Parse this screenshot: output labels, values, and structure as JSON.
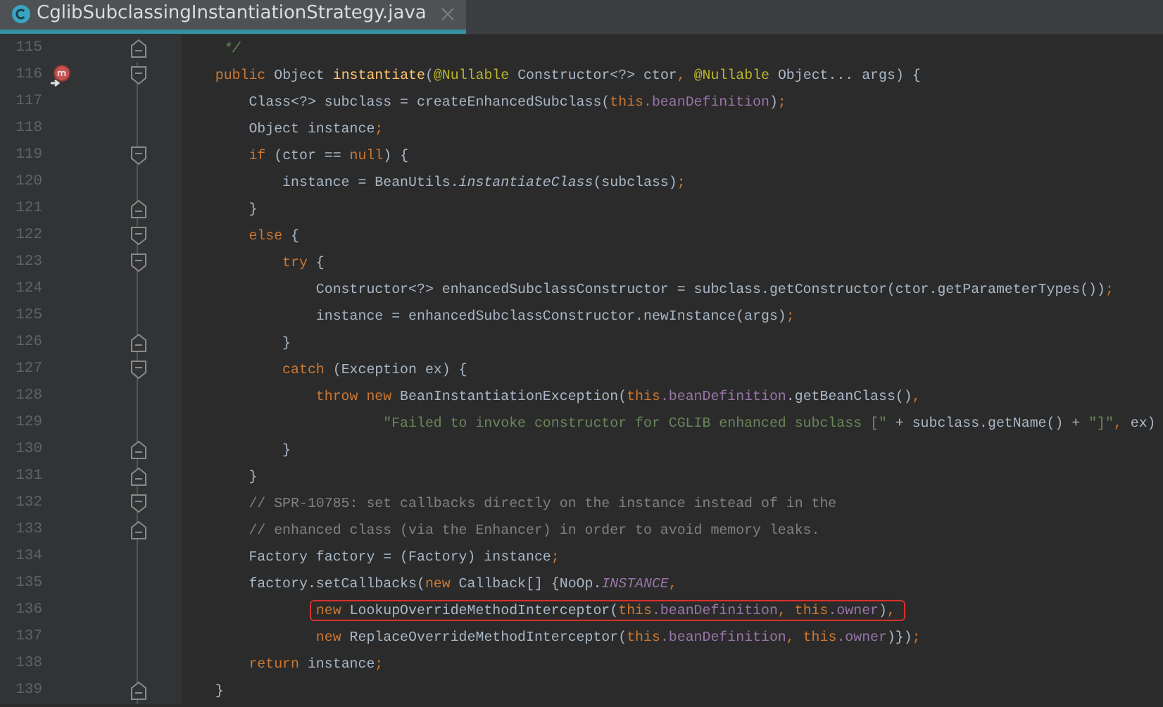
{
  "tab": {
    "title": "CglibSubclassingInstantiationStrategy.java",
    "selected": true
  },
  "lines": [
    {
      "number": "115",
      "fold_end": true,
      "tokens": [
        {
          "kind": "doc",
          "text": "     */"
        }
      ]
    },
    {
      "number": "116",
      "fold_start": true,
      "override_marker": true,
      "tokens": [
        {
          "kind": "keyword",
          "text": "    public"
        },
        {
          "kind": "plain",
          "text": " Object "
        },
        {
          "kind": "method",
          "text": "instantiate"
        },
        {
          "kind": "plain",
          "text": "("
        },
        {
          "kind": "annotation",
          "text": "@Nullable"
        },
        {
          "kind": "plain",
          "text": " Constructor<?> ctor"
        },
        {
          "kind": "punct",
          "text": ","
        },
        {
          "kind": "annotation",
          "text": " @Nullable"
        },
        {
          "kind": "plain",
          "text": " Object... args) {"
        }
      ]
    },
    {
      "number": "117",
      "tokens": [
        {
          "kind": "plain",
          "text": "        Class<?> subclass = createEnhancedSubclass("
        },
        {
          "kind": "keyword",
          "text": "this"
        },
        {
          "kind": "field",
          "text": ".beanDefinition"
        },
        {
          "kind": "plain",
          "text": ")"
        },
        {
          "kind": "punct",
          "text": ";"
        }
      ]
    },
    {
      "number": "118",
      "tokens": [
        {
          "kind": "plain",
          "text": "        Object instance"
        },
        {
          "kind": "punct",
          "text": ";"
        }
      ]
    },
    {
      "number": "119",
      "fold_start": true,
      "tokens": [
        {
          "kind": "keyword",
          "text": "        if"
        },
        {
          "kind": "plain",
          "text": " (ctor == "
        },
        {
          "kind": "keyword",
          "text": "null"
        },
        {
          "kind": "plain",
          "text": ") {"
        }
      ]
    },
    {
      "number": "120",
      "tokens": [
        {
          "kind": "plain",
          "text": "            instance = BeanUtils."
        },
        {
          "kind": "static_method",
          "text": "instantiateClass"
        },
        {
          "kind": "plain",
          "text": "(subclass)"
        },
        {
          "kind": "punct",
          "text": ";"
        }
      ]
    },
    {
      "number": "121",
      "fold_end": true,
      "tokens": [
        {
          "kind": "plain",
          "text": "        }"
        }
      ]
    },
    {
      "number": "122",
      "fold_start": true,
      "tokens": [
        {
          "kind": "keyword",
          "text": "        else"
        },
        {
          "kind": "plain",
          "text": " {"
        }
      ]
    },
    {
      "number": "123",
      "fold_start": true,
      "tokens": [
        {
          "kind": "keyword",
          "text": "            try"
        },
        {
          "kind": "plain",
          "text": " {"
        }
      ]
    },
    {
      "number": "124",
      "tokens": [
        {
          "kind": "plain",
          "text": "                Constructor<?> enhancedSubclassConstructor = subclass.getConstructor(ctor.getParameterTypes())"
        },
        {
          "kind": "punct",
          "text": ";"
        }
      ]
    },
    {
      "number": "125",
      "tokens": [
        {
          "kind": "plain",
          "text": "                instance = enhancedSubclassConstructor.newInstance(args)"
        },
        {
          "kind": "punct",
          "text": ";"
        }
      ]
    },
    {
      "number": "126",
      "fold_end": true,
      "tokens": [
        {
          "kind": "plain",
          "text": "            }"
        }
      ]
    },
    {
      "number": "127",
      "fold_start": true,
      "tokens": [
        {
          "kind": "keyword",
          "text": "            catch"
        },
        {
          "kind": "plain",
          "text": " (Exception ex) {"
        }
      ]
    },
    {
      "number": "128",
      "tokens": [
        {
          "kind": "keyword",
          "text": "                throw new"
        },
        {
          "kind": "plain",
          "text": " BeanInstantiationException("
        },
        {
          "kind": "keyword",
          "text": "this"
        },
        {
          "kind": "field",
          "text": ".beanDefinition"
        },
        {
          "kind": "plain",
          "text": ".getBeanClass()"
        },
        {
          "kind": "punct",
          "text": ","
        }
      ]
    },
    {
      "number": "129",
      "tokens": [
        {
          "kind": "string",
          "text": "                        \"Failed to invoke constructor for CGLIB enhanced subclass [\""
        },
        {
          "kind": "plain",
          "text": " + subclass.getName() + "
        },
        {
          "kind": "string",
          "text": "\"]\""
        },
        {
          "kind": "punct",
          "text": ","
        },
        {
          "kind": "plain",
          "text": " ex)"
        }
      ]
    },
    {
      "number": "130",
      "fold_end": true,
      "tokens": [
        {
          "kind": "plain",
          "text": "            }"
        }
      ]
    },
    {
      "number": "131",
      "fold_end": true,
      "tokens": [
        {
          "kind": "plain",
          "text": "        }"
        }
      ]
    },
    {
      "number": "132",
      "fold_start": true,
      "tokens": [
        {
          "kind": "comment",
          "text": "        // SPR-10785: set callbacks directly on the instance instead of in the"
        }
      ]
    },
    {
      "number": "133",
      "fold_end": true,
      "tokens": [
        {
          "kind": "comment",
          "text": "        // enhanced class (via the Enhancer) in order to avoid memory leaks."
        }
      ]
    },
    {
      "number": "134",
      "tokens": [
        {
          "kind": "plain",
          "text": "        Factory factory = (Factory) instance"
        },
        {
          "kind": "punct",
          "text": ";"
        }
      ]
    },
    {
      "number": "135",
      "tokens": [
        {
          "kind": "plain",
          "text": "        factory.setCallbacks("
        },
        {
          "kind": "keyword",
          "text": "new"
        },
        {
          "kind": "plain",
          "text": " Callback[] {NoOp."
        },
        {
          "kind": "static_field",
          "text": "INSTANCE"
        },
        {
          "kind": "punct",
          "text": ","
        }
      ]
    },
    {
      "number": "136",
      "boxed": true,
      "tokens": [
        {
          "kind": "keyword",
          "text": "                new"
        },
        {
          "kind": "plain",
          "text": " LookupOverrideMethodInterceptor("
        },
        {
          "kind": "keyword",
          "text": "this"
        },
        {
          "kind": "field",
          "text": ".beanDefinition"
        },
        {
          "kind": "punct",
          "text": ","
        },
        {
          "kind": "keyword",
          "text": " this"
        },
        {
          "kind": "field",
          "text": ".owner"
        },
        {
          "kind": "plain",
          "text": ")"
        },
        {
          "kind": "punct",
          "text": ","
        }
      ]
    },
    {
      "number": "137",
      "tokens": [
        {
          "kind": "keyword",
          "text": "                new"
        },
        {
          "kind": "plain",
          "text": " ReplaceOverrideMethodInterceptor("
        },
        {
          "kind": "keyword",
          "text": "this"
        },
        {
          "kind": "field",
          "text": ".beanDefinition"
        },
        {
          "kind": "punct",
          "text": ","
        },
        {
          "kind": "keyword",
          "text": " this"
        },
        {
          "kind": "field",
          "text": ".owner"
        },
        {
          "kind": "plain",
          "text": ")})"
        },
        {
          "kind": "punct",
          "text": ";"
        }
      ]
    },
    {
      "number": "138",
      "tokens": [
        {
          "kind": "keyword",
          "text": "        return"
        },
        {
          "kind": "plain",
          "text": " instance"
        },
        {
          "kind": "punct",
          "text": ";"
        }
      ]
    },
    {
      "number": "139",
      "fold_end": true,
      "tokens": [
        {
          "kind": "plain",
          "text": "    }"
        }
      ]
    }
  ]
}
